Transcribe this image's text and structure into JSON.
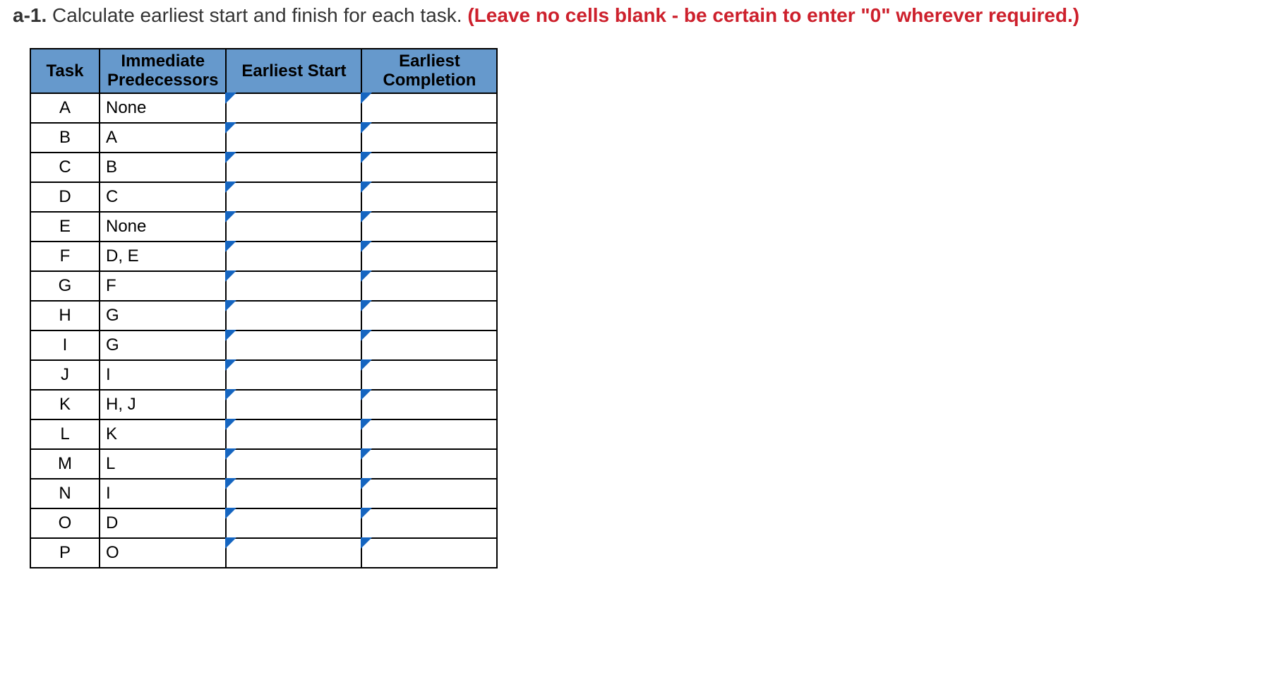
{
  "prompt": {
    "qnum": "a-1.",
    "instruction": "Calculate earliest start and finish for each task.",
    "warning": "(Leave no cells blank - be certain to enter \"0\" wherever required.)"
  },
  "table": {
    "headers": {
      "task": "Task",
      "pred": "Immediate Predecessors",
      "es": "Earliest Start",
      "ec": "Earliest Completion"
    },
    "rows": [
      {
        "task": "A",
        "pred": "None",
        "es": "",
        "ec": ""
      },
      {
        "task": "B",
        "pred": "A",
        "es": "",
        "ec": ""
      },
      {
        "task": "C",
        "pred": "B",
        "es": "",
        "ec": ""
      },
      {
        "task": "D",
        "pred": "C",
        "es": "",
        "ec": ""
      },
      {
        "task": "E",
        "pred": "None",
        "es": "",
        "ec": ""
      },
      {
        "task": "F",
        "pred": "D, E",
        "es": "",
        "ec": ""
      },
      {
        "task": "G",
        "pred": "F",
        "es": "",
        "ec": ""
      },
      {
        "task": "H",
        "pred": "G",
        "es": "",
        "ec": ""
      },
      {
        "task": "I",
        "pred": "G",
        "es": "",
        "ec": ""
      },
      {
        "task": "J",
        "pred": "I",
        "es": "",
        "ec": ""
      },
      {
        "task": "K",
        "pred": "H, J",
        "es": "",
        "ec": ""
      },
      {
        "task": "L",
        "pred": "K",
        "es": "",
        "ec": ""
      },
      {
        "task": "M",
        "pred": "L",
        "es": "",
        "ec": ""
      },
      {
        "task": "N",
        "pred": "I",
        "es": "",
        "ec": ""
      },
      {
        "task": "O",
        "pred": "D",
        "es": "",
        "ec": ""
      },
      {
        "task": "P",
        "pred": "O",
        "es": "",
        "ec": ""
      }
    ]
  }
}
